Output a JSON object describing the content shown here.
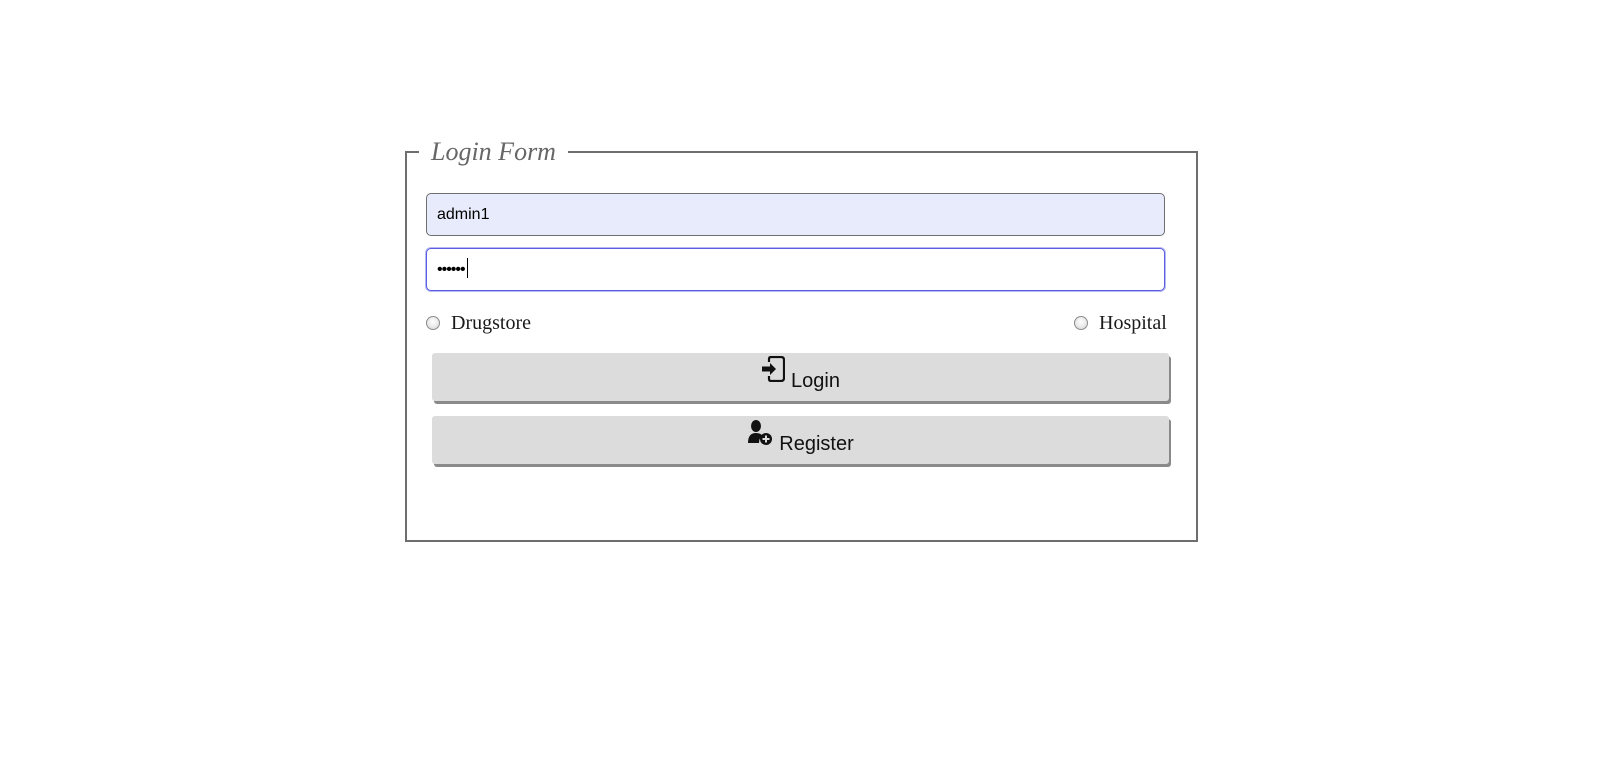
{
  "form": {
    "legend": "Login Form",
    "username_value": "admin1",
    "password_value": "••••••"
  },
  "role_options": [
    {
      "label": "Drugstore",
      "selected": false
    },
    {
      "label": "Hospital",
      "selected": false
    }
  ],
  "buttons": {
    "login_label": "Login",
    "login_icon": "sign-in-icon",
    "register_label": "Register",
    "register_icon": "user-plus-icon"
  }
}
